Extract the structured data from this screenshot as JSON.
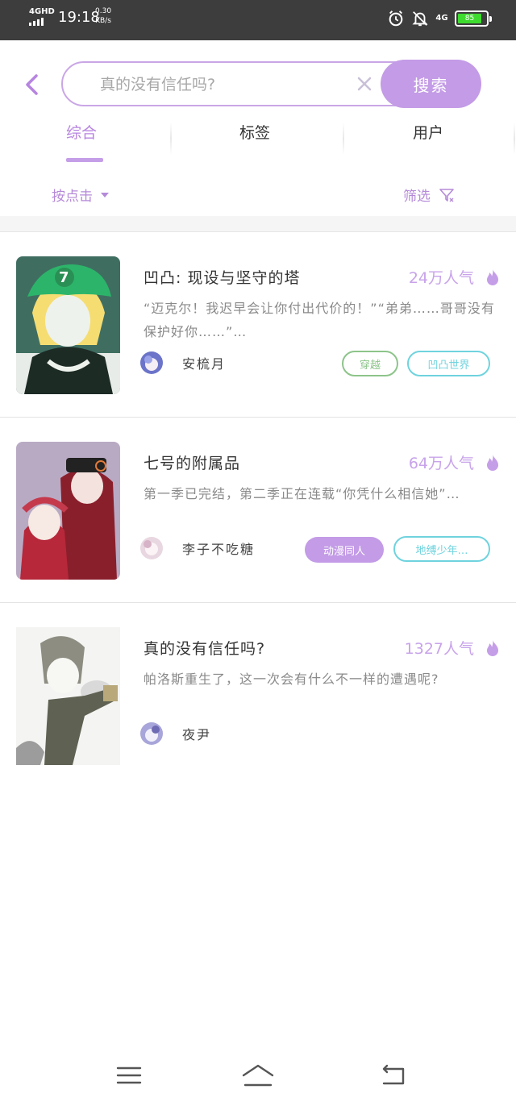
{
  "status_bar": {
    "network": "4GHD",
    "time": "19:18",
    "speed_value": "0.30",
    "speed_unit": "KB/s",
    "network_right": "4G",
    "battery": "85",
    "icons": [
      "signal-icon",
      "alarm-icon",
      "mute-icon",
      "battery-icon"
    ]
  },
  "search": {
    "placeholder": "真的没有信任吗?",
    "button_label": "搜索"
  },
  "tabs": [
    {
      "label": "综合",
      "active": true
    },
    {
      "label": "标签",
      "active": false
    },
    {
      "label": "用户",
      "active": false
    }
  ],
  "filters": {
    "sort_label": "按点击",
    "filter_label": "筛选"
  },
  "colors": {
    "accent": "#c39be6",
    "accent_text": "#b784e0",
    "tag_green": "#8dc48a",
    "tag_cyan": "#6fd3de"
  },
  "results": [
    {
      "title": "凹凸: 现设与坚守的塔",
      "popularity": "24万人气",
      "description": "“迈克尔！我迟早会让你付出代价的！”“弟弟……哥哥没有保护好你……”…",
      "author": "安梳月",
      "tags": [
        {
          "label": "穿越",
          "style": "outline-green"
        },
        {
          "label": "凹凸世界",
          "style": "outline-cyan"
        }
      ]
    },
    {
      "title": "七号的附属品",
      "popularity": "64万人气",
      "description": "第一季已完结，第二季正在连载“你凭什么相信她”…",
      "author": "李子不吃糖",
      "tags": [
        {
          "label": "动漫同人",
          "style": "filled-purple"
        },
        {
          "label": "地缚少年…",
          "style": "outline-cyan"
        }
      ]
    },
    {
      "title": "真的没有信任吗?",
      "popularity": "1327人气",
      "description": "帕洛斯重生了，这一次会有什么不一样的遭遇呢?",
      "author": "夜尹",
      "tags": []
    }
  ],
  "nav": {
    "icons": [
      "menu-icon",
      "home-icon",
      "back-icon"
    ]
  }
}
